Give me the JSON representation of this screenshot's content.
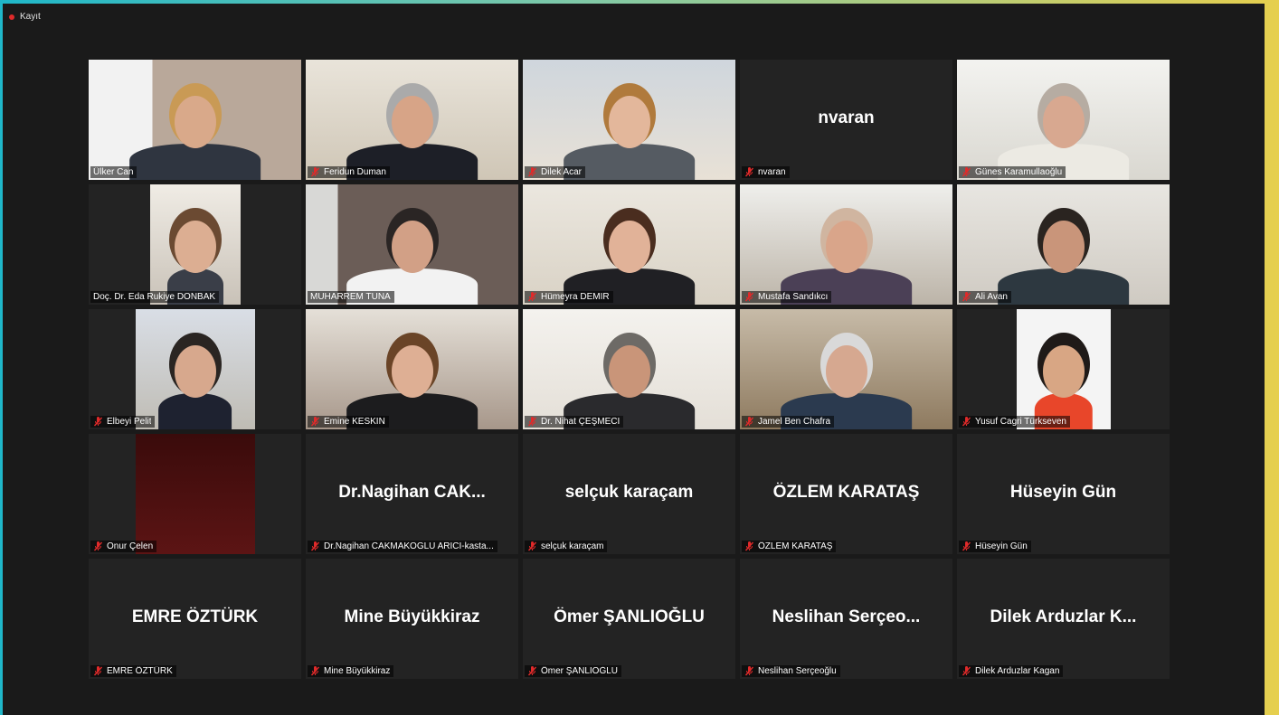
{
  "recording": {
    "label": "Kayıt"
  },
  "colors": {
    "tile_bg": "#232323",
    "active_border": "#b6d63a",
    "mute_red": "#e02a2a"
  },
  "participants": [
    {
      "name": "Ülker Can",
      "muted": false,
      "video": true
    },
    {
      "name": "Feridun Duman",
      "muted": true,
      "video": true
    },
    {
      "name": "Dilek Acar",
      "muted": true,
      "video": true
    },
    {
      "name": "nvaran",
      "muted": true,
      "video": false,
      "display": "nvaran"
    },
    {
      "name": "Günes Karamullaoğlu",
      "muted": true,
      "video": true
    },
    {
      "name": "Doç. Dr. Eda Rukiye DONBAK",
      "muted": false,
      "video": true
    },
    {
      "name": "MUHARREM TUNA",
      "muted": false,
      "video": true,
      "active": true
    },
    {
      "name": "Hümeyra DEMİR",
      "muted": true,
      "video": true
    },
    {
      "name": "Mustafa Sandıkcı",
      "muted": true,
      "video": true
    },
    {
      "name": "Ali Avan",
      "muted": true,
      "video": true
    },
    {
      "name": "Elbeyi Pelit",
      "muted": true,
      "video": true
    },
    {
      "name": "Emine KESKİN",
      "muted": true,
      "video": true
    },
    {
      "name": "Dr. Nihat ÇEŞMECİ",
      "muted": true,
      "video": true
    },
    {
      "name": "Jamel Ben Chafra",
      "muted": true,
      "video": true
    },
    {
      "name": "Yusuf Cagri Türkseven",
      "muted": true,
      "video": true
    },
    {
      "name": "Onur Çelen",
      "muted": true,
      "video": true
    },
    {
      "name": "Dr.Nagihan CAKMAKOGLU ARICI-kasta...",
      "muted": true,
      "video": false,
      "display": "Dr.Nagihan  CAK..."
    },
    {
      "name": "selçuk karaçam",
      "muted": true,
      "video": false,
      "display": "selçuk karaçam"
    },
    {
      "name": "ÖZLEM KARATAŞ",
      "muted": true,
      "video": false,
      "display": "ÖZLEM KARATAŞ"
    },
    {
      "name": "Hüseyin Gün",
      "muted": true,
      "video": false,
      "display": "Hüseyin Gün"
    },
    {
      "name": "EMRE ÖZTÜRK",
      "muted": true,
      "video": false,
      "display": "EMRE ÖZTÜRK"
    },
    {
      "name": "Mine Büyükkiraz",
      "muted": true,
      "video": false,
      "display": "Mine Büyükkiraz"
    },
    {
      "name": "Ömer ŞANLIOĞLU",
      "muted": true,
      "video": false,
      "display": "Ömer ŞANLIOĞLU"
    },
    {
      "name": "Neslihan Serçeoğlu",
      "muted": true,
      "video": false,
      "display": "Neslihan  Serçeo..."
    },
    {
      "name": "Dilek Arduzlar Kagan",
      "muted": true,
      "video": false,
      "display": "Dilek  Arduzlar  K..."
    }
  ]
}
